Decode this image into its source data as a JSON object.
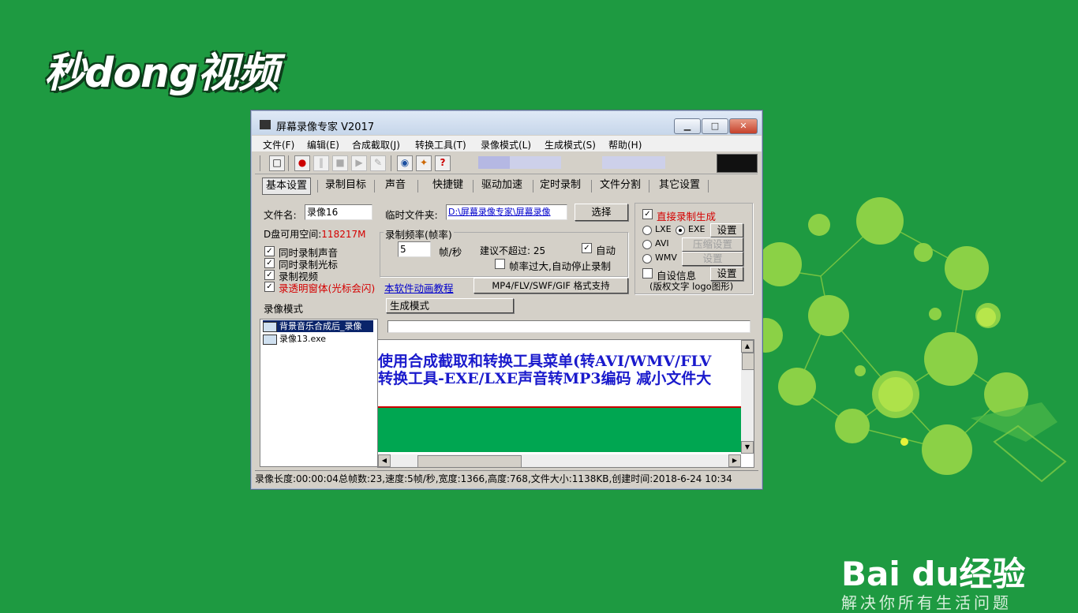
{
  "watermark": {
    "brand": "秒dong视频",
    "baidu": "Bai du经验",
    "baidu_slogan": "解决你所有生活问题"
  },
  "window": {
    "title": "屏幕录像专家 V2017",
    "controls": {
      "minimize": "▁",
      "maximize": "□",
      "close": "✕"
    },
    "menu": [
      "文件(F)",
      "编辑(E)",
      "合成截取(J)",
      "转换工具(T)",
      "录像模式(L)",
      "生成模式(S)",
      "帮助(H)"
    ],
    "tabs": [
      "基本设置",
      "录制目标",
      "声音",
      "快捷键",
      "驱动加速",
      "定时录制",
      "文件分割",
      "其它设置"
    ],
    "basic": {
      "filename_label": "文件名:",
      "filename_value": "录像16",
      "disk_space_label": "D盘可用空间:",
      "disk_space_value": "118217M",
      "temp_folder_label": "临时文件夹:",
      "temp_folder_value": "D:\\屏幕录像专家\\屏幕录像",
      "browse_button": "选择",
      "framerate_group": "录制频率(帧率)",
      "framerate_value": "5",
      "framerate_unit": "帧/秒",
      "framerate_hint": "建议不超过: 25",
      "auto_label": "自动",
      "auto_stop_label": "帧率过大,自动停止录制",
      "options": [
        "同时录制声音",
        "同时录制光标",
        "录制视频",
        "录透明窗体(光标会闪)"
      ],
      "tutorial_link": "本软件动画教程",
      "format_button": "MP4/FLV/SWF/GIF  格式支持",
      "direct_gen_label": "直接录制生成",
      "lxe": "LXE",
      "exe": "EXE",
      "avi": "AVI",
      "wmv": "WMV",
      "settings_button": "设置",
      "compress_settings_button": "压缩设置",
      "custom_info_label": "自设信息",
      "logo_hint": "(版权文字 logo图形)"
    },
    "record_mode_label": "录像模式",
    "gen_mode_label": "生成模式",
    "recordings": [
      "背景音乐合成后_录像",
      "录像13.exe"
    ],
    "preview": {
      "line1": "使用合成截取和转换工具菜单(转AVI/WMV/FLV",
      "line2": "转换工具-EXE/LXE声音转MP3编码 减小文件大"
    },
    "status": "录像长度:00:00:04总帧数:23,速度:5帧/秒,宽度:1366,高度:768,文件大小:1138KB,创建时间:2018-6-24 10:34"
  },
  "colors": {
    "desktop_bg": "#1e9a41",
    "preview_text": "#1a1acc",
    "accent_red": "#d40000"
  }
}
